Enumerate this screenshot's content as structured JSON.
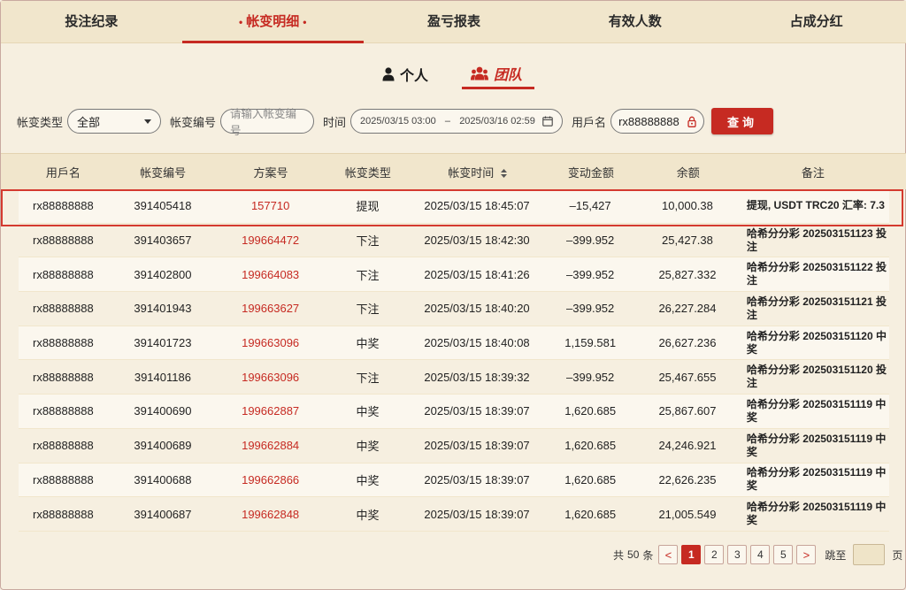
{
  "top_tabs": [
    {
      "label": "投注纪录"
    },
    {
      "label": "帐变明细",
      "active": true
    },
    {
      "label": "盈亏报表"
    },
    {
      "label": "有效人数"
    },
    {
      "label": "占成分红"
    }
  ],
  "active_tab_dot": "•",
  "sub_toggle": {
    "personal": "个人",
    "team": "团队",
    "active": "team"
  },
  "filters": {
    "type_label": "帐变类型",
    "type_value": "全部",
    "number_label": "帐变编号",
    "number_placeholder": "请输入帐变编号",
    "time_label": "时间",
    "time_start": "2025/03/15 03:00",
    "time_sep": "–",
    "time_end": "2025/03/16 02:59",
    "username_label": "用戶名",
    "username_value": "rx88888888",
    "query_button": "查询"
  },
  "table": {
    "headers": [
      "用戶名",
      "帐变编号",
      "方案号",
      "帐变类型",
      "帐变时间",
      "变动金额",
      "余额",
      "备注"
    ],
    "rows": [
      [
        "rx88888888",
        "391405418",
        "157710",
        "提现",
        "2025/03/15 18:45:07",
        "–15,427",
        "10,000.38",
        "提现, USDT TRC20 汇率: 7.3"
      ],
      [
        "rx88888888",
        "391403657",
        "199664472",
        "下注",
        "2025/03/15 18:42:30",
        "–399.952",
        "25,427.38",
        "哈希分分彩 202503151123 投注"
      ],
      [
        "rx88888888",
        "391402800",
        "199664083",
        "下注",
        "2025/03/15 18:41:26",
        "–399.952",
        "25,827.332",
        "哈希分分彩 202503151122 投注"
      ],
      [
        "rx88888888",
        "391401943",
        "199663627",
        "下注",
        "2025/03/15 18:40:20",
        "–399.952",
        "26,227.284",
        "哈希分分彩 202503151121 投注"
      ],
      [
        "rx88888888",
        "391401723",
        "199663096",
        "中奖",
        "2025/03/15 18:40:08",
        "1,159.581",
        "26,627.236",
        "哈希分分彩 202503151120 中奖"
      ],
      [
        "rx88888888",
        "391401186",
        "199663096",
        "下注",
        "2025/03/15 18:39:32",
        "–399.952",
        "25,467.655",
        "哈希分分彩 202503151120 投注"
      ],
      [
        "rx88888888",
        "391400690",
        "199662887",
        "中奖",
        "2025/03/15 18:39:07",
        "1,620.685",
        "25,867.607",
        "哈希分分彩 202503151119 中奖"
      ],
      [
        "rx88888888",
        "391400689",
        "199662884",
        "中奖",
        "2025/03/15 18:39:07",
        "1,620.685",
        "24,246.921",
        "哈希分分彩 202503151119 中奖"
      ],
      [
        "rx88888888",
        "391400688",
        "199662866",
        "中奖",
        "2025/03/15 18:39:07",
        "1,620.685",
        "22,626.235",
        "哈希分分彩 202503151119 中奖"
      ],
      [
        "rx88888888",
        "391400687",
        "199662848",
        "中奖",
        "2025/03/15 18:39:07",
        "1,620.685",
        "21,005.549",
        "哈希分分彩 202503151119 中奖"
      ]
    ]
  },
  "pagination": {
    "total_prefix": "共",
    "total_count": "50",
    "total_suffix": "条",
    "prev": "<",
    "next": ">",
    "pages": [
      "1",
      "2",
      "3",
      "4",
      "5"
    ],
    "current": "1",
    "jump_label": "跳至",
    "jump_suffix": "页"
  },
  "colors": {
    "accent": "#c62a22",
    "background": "#f6efe0",
    "header_bg": "#f1e6cc"
  }
}
